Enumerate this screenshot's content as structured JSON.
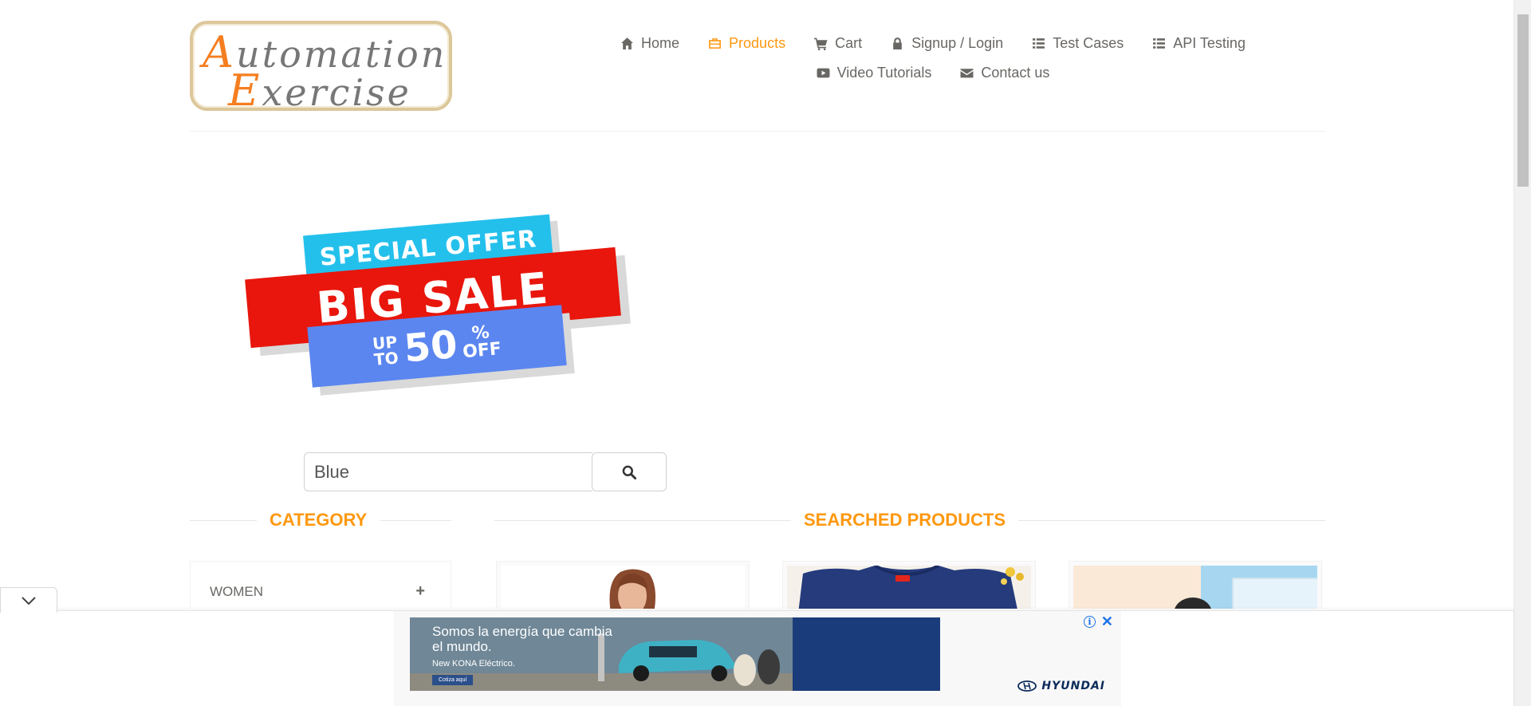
{
  "logo": {
    "line1_cap": "A",
    "line1_rest": "utomation",
    "line2_cap": "E",
    "line2_rest": "xercise"
  },
  "nav": {
    "row1": [
      {
        "label": "Home",
        "icon": "home-icon",
        "active": false
      },
      {
        "label": "Products",
        "icon": "products-icon",
        "active": true
      },
      {
        "label": "Cart",
        "icon": "cart-icon",
        "active": false
      },
      {
        "label": "Signup / Login",
        "icon": "lock-icon",
        "active": false
      },
      {
        "label": "Test Cases",
        "icon": "list-icon",
        "active": false
      },
      {
        "label": "API Testing",
        "icon": "list-icon",
        "active": false
      }
    ],
    "row2": [
      {
        "label": "Video Tutorials",
        "icon": "youtube-icon",
        "active": false
      },
      {
        "label": "Contact us",
        "icon": "envelope-icon",
        "active": false
      }
    ],
    "active_color": "#fe980f"
  },
  "banner": {
    "top": "SPECIAL OFFER",
    "middle": "BIG SALE",
    "up": "UP",
    "to": "TO",
    "amount": "50",
    "percent": "%",
    "off": "OFF"
  },
  "search": {
    "value": "Blue",
    "button_icon": "search-icon"
  },
  "sections": {
    "category_title": "CATEGORY",
    "products_title": "SEARCHED PRODUCTS"
  },
  "category": {
    "items": [
      {
        "label": "WOMEN",
        "toggle": "+"
      }
    ]
  },
  "ad": {
    "headline": "Somos la energía que cambia el mundo.",
    "subline": "New KONA Eléctrico.",
    "cta": "Cotiza aquí",
    "brand": "HYUNDAI",
    "info": "i",
    "close": "✕"
  }
}
